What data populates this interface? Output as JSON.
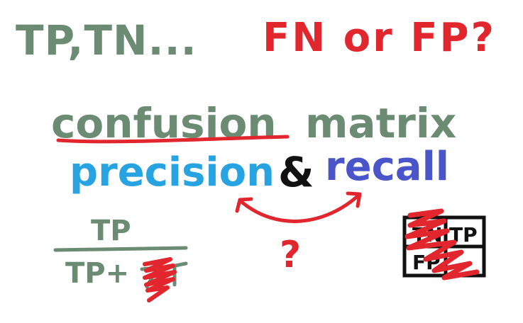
{
  "notes": {
    "tp_tn": "TP,TN...",
    "fn_fp": "FN or FP?",
    "confusion": "confusion",
    "matrix": "matrix",
    "precision": "precision",
    "ampersand": "&",
    "recall": "recall",
    "question": "?",
    "fraction_numerator": "TP",
    "fraction_denominator": "TP+",
    "matrix_box_top_left": "TN",
    "matrix_box_top_right": "TP",
    "matrix_box_bottom_left": "FP"
  },
  "colors": {
    "green_ink": "#6c8b73",
    "red_ink": "#e2262e",
    "blue_ink": "#27a3e1",
    "purple_blue_ink": "#4a55c9",
    "black_ink": "#111111",
    "background": "#ffffff"
  }
}
